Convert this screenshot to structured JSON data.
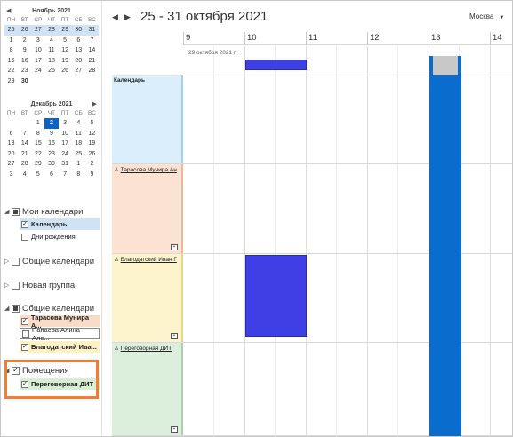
{
  "mini_calendar": {
    "weekday_names": [
      "ПН",
      "ВТ",
      "СР",
      "ЧТ",
      "ПТ",
      "СБ",
      "ВС"
    ],
    "months": [
      {
        "title": "Ноябрь 2021",
        "weeks": [
          [
            "25",
            "26",
            "27",
            "28",
            "29",
            "30",
            "31"
          ],
          [
            "1",
            "2",
            "3",
            "4",
            "5",
            "6",
            "7"
          ],
          [
            "8",
            "9",
            "10",
            "11",
            "12",
            "13",
            "14"
          ],
          [
            "15",
            "16",
            "17",
            "18",
            "19",
            "20",
            "21"
          ],
          [
            "22",
            "23",
            "24",
            "25",
            "26",
            "27",
            "28"
          ],
          [
            "29",
            "30",
            "",
            "",
            "",
            "",
            ""
          ]
        ]
      },
      {
        "title": "Декабрь 2021",
        "weeks": [
          [
            "",
            "",
            "1",
            "2",
            "3",
            "4",
            "5"
          ],
          [
            "6",
            "7",
            "8",
            "9",
            "10",
            "11",
            "12"
          ],
          [
            "13",
            "14",
            "15",
            "16",
            "17",
            "18",
            "19"
          ],
          [
            "20",
            "21",
            "22",
            "23",
            "24",
            "25",
            "26"
          ],
          [
            "27",
            "28",
            "29",
            "30",
            "31",
            "1",
            "2"
          ],
          [
            "3",
            "4",
            "5",
            "6",
            "7",
            "8",
            "9"
          ]
        ]
      }
    ],
    "today": "2"
  },
  "nav": {
    "my_calendars": {
      "label": "Мои календари",
      "items": [
        "Календарь",
        "Дни рождения"
      ]
    },
    "shared_calendars_1": {
      "label": "Общие календари"
    },
    "new_group": {
      "label": "Новая группа"
    },
    "shared_calendars_2": {
      "label": "Общие календари",
      "items": [
        "Тарасова Мунира А...",
        "Папаева Алина Але...",
        "Благодатский Ива..."
      ]
    },
    "rooms": {
      "label": "Помещения",
      "items": [
        "Переговорная ДИТ"
      ]
    }
  },
  "view": {
    "title": "25 - 31 октября 2021",
    "timezone": "Москва",
    "hours": [
      "9",
      "10",
      "11",
      "12",
      "13",
      "14"
    ],
    "date_label": "29 октября 2021 г.",
    "rows": [
      {
        "label": "Календарь"
      },
      {
        "label": "Тарасова Мунира Ан"
      },
      {
        "label": "Благодатский Иван Г"
      },
      {
        "label": "Переговорная ДИТ"
      }
    ]
  },
  "colors": {
    "accent": "#0a64c0",
    "meeting_blue": "#0a6ccc",
    "meeting_indigo": "#3f3fe6",
    "highlight_box": "#f47c2c"
  },
  "icons": {
    "prev": "chevron-left-icon",
    "next": "chevron-right-icon",
    "expand": "triangle-icon",
    "person": "person-icon",
    "add_event": "add-event-icon"
  }
}
